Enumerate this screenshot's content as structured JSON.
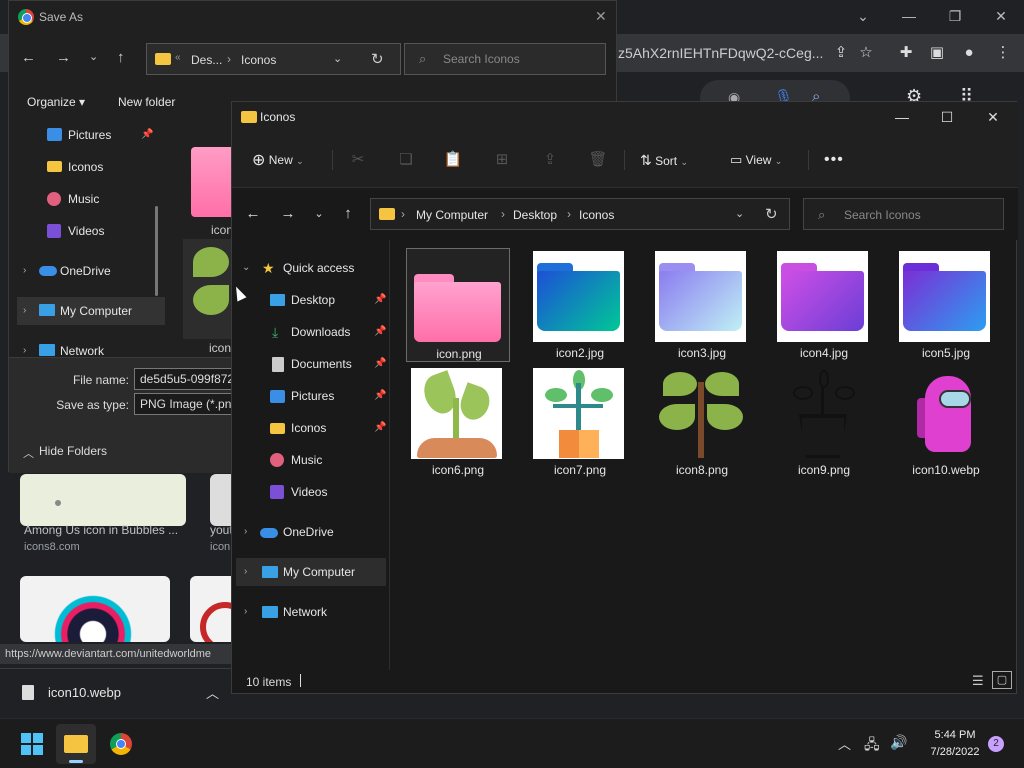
{
  "browser": {
    "url_fragment": "z5AhX2rnIEHTnFDqwQ2-cCeg...",
    "results": [
      {
        "title": "Among Us icon in Bubbles ...",
        "source": "icons8.com"
      },
      {
        "title": "youtu",
        "source": "icon"
      }
    ],
    "status_url": "https://www.deviantart.com/unitedworldme",
    "download_file": "icon10.webp"
  },
  "saveas": {
    "title": "Save As",
    "breadcrumb": [
      "Des...",
      "Iconos"
    ],
    "search_placeholder": "Search Iconos",
    "organize_label": "Organize",
    "new_folder_label": "New folder",
    "sidebar": [
      "Pictures",
      "Iconos",
      "Music",
      "Videos",
      "OneDrive",
      "My Computer",
      "Network"
    ],
    "peek_label": "icon",
    "file_name_label": "File name:",
    "file_name_value": "de5d5u5-099f872",
    "save_as_type_label": "Save as type:",
    "save_as_type_value": "PNG Image (*.png",
    "hide_folders_label": "Hide Folders"
  },
  "explorer": {
    "title": "Iconos",
    "new_label": "New",
    "sort_label": "Sort",
    "view_label": "View",
    "breadcrumb": [
      "My Computer",
      "Desktop",
      "Iconos"
    ],
    "search_placeholder": "Search Iconos",
    "sidebar": {
      "quick_access": "Quick access",
      "items": [
        "Desktop",
        "Downloads",
        "Documents",
        "Pictures",
        "Iconos",
        "Music",
        "Videos"
      ],
      "onedrive": "OneDrive",
      "my_computer": "My Computer",
      "network": "Network"
    },
    "files": [
      {
        "name": "icon.png"
      },
      {
        "name": "icon2.jpg"
      },
      {
        "name": "icon3.jpg"
      },
      {
        "name": "icon4.jpg"
      },
      {
        "name": "icon5.jpg"
      },
      {
        "name": "icon6.png"
      },
      {
        "name": "icon7.png"
      },
      {
        "name": "icon8.png"
      },
      {
        "name": "icon9.png"
      },
      {
        "name": "icon10.webp"
      }
    ],
    "item_count": "10 items"
  },
  "taskbar": {
    "time": "5:44 PM",
    "date": "7/28/2022",
    "notification_count": "2"
  },
  "colors": {
    "folder_yellow": "#f5c542",
    "accent": "#0078d4",
    "among_us_pink": "#e040d0"
  }
}
